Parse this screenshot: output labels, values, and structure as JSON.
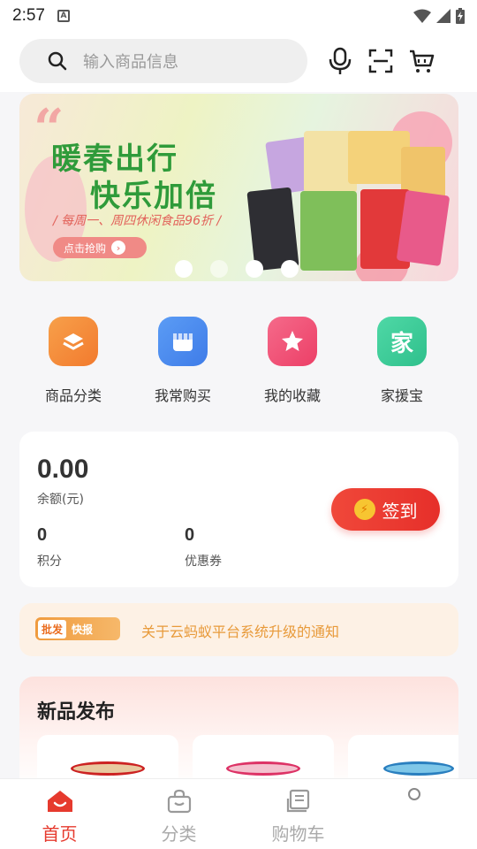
{
  "status_bar": {
    "time": "2:57"
  },
  "search": {
    "placeholder": "输入商品信息"
  },
  "banner": {
    "title_line1": "暖春出行",
    "title_line2": "快乐加倍",
    "subtitle": "/ 每周一、周四休闲食品96折 /",
    "cta": "点击抢购",
    "active_dot": 0,
    "dot_count": 4
  },
  "quick_menu": [
    {
      "label": "商品分类",
      "icon": "category-icon",
      "color": "#f58b3c"
    },
    {
      "label": "我常购买",
      "icon": "store-icon",
      "color": "#4f8ff2"
    },
    {
      "label": "我的收藏",
      "icon": "star-icon",
      "color": "#f0527a"
    },
    {
      "label": "家援宝",
      "icon": "home-text-icon",
      "glyph": "家",
      "color": "#3ccf9d"
    }
  ],
  "wallet": {
    "balance": "0.00",
    "balance_label": "余额(元)",
    "points": "0",
    "points_label": "积分",
    "coupons": "0",
    "coupons_label": "优惠券",
    "signin_label": "签到"
  },
  "notice": {
    "tag_left": "批发",
    "tag_right": "快报",
    "text": "关于云蚂蚁平台系统升级的通知"
  },
  "new_products": {
    "title": "新品发布"
  },
  "bottom_nav": [
    {
      "label": "首页",
      "icon": "home-icon",
      "active": true
    },
    {
      "label": "分类",
      "icon": "bag-icon",
      "active": false
    },
    {
      "label": "购物车",
      "icon": "cart-list-icon",
      "active": false
    }
  ],
  "colors": {
    "accent": "#e63a2e",
    "notice_text": "#e89a3a",
    "banner_green": "#2f9b3a"
  }
}
